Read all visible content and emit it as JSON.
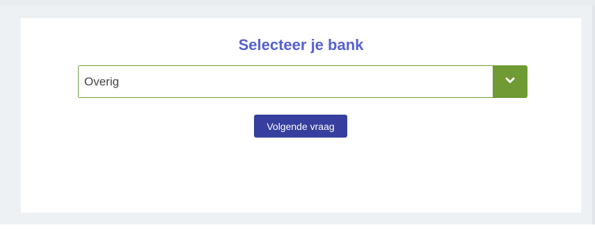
{
  "question": {
    "title": "Selecteer je bank"
  },
  "bank_select": {
    "selected_value": "Overig",
    "toggle_icon": "chevron-down-icon"
  },
  "actions": {
    "next_label": "Volgende vraag"
  },
  "colors": {
    "title": "#5660d3",
    "select_border": "#6d9c3a",
    "select_toggle": "#6f9a34",
    "next_button": "#363e9e",
    "page_background": "#e9ecef",
    "card_background": "#ffffff"
  }
}
